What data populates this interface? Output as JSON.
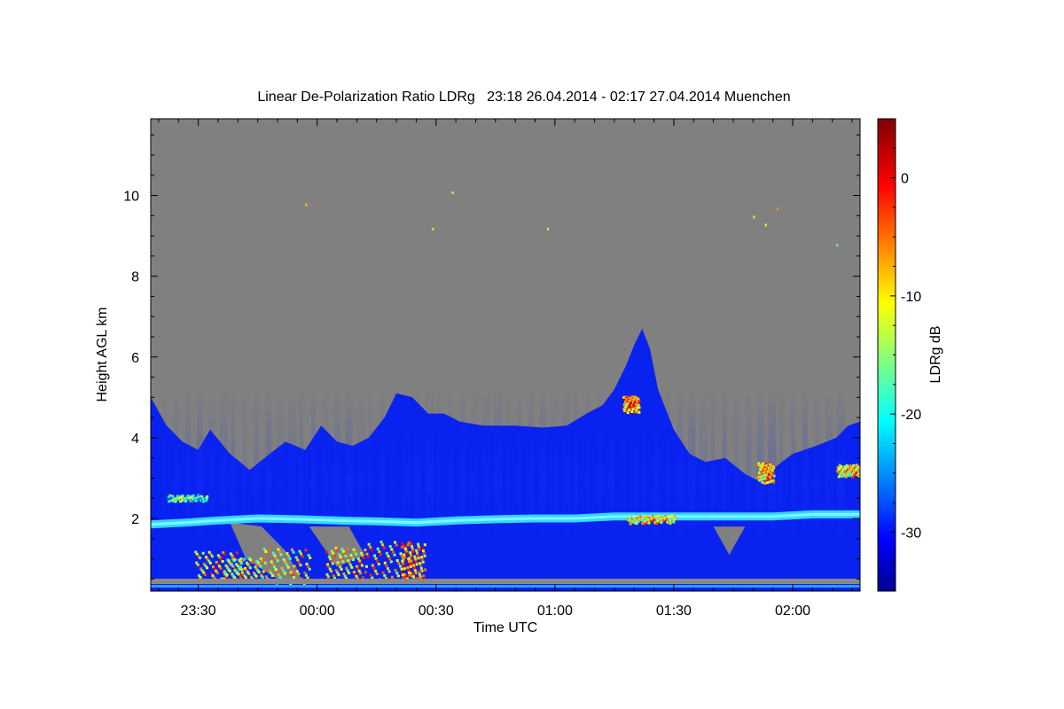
{
  "chart_data": {
    "type": "heatmap",
    "title": "Linear De-Polarization Ratio LDRg   23:18 26.04.2014 - 02:17 27.04.2014 Muenchen",
    "xlabel": "Time UTC",
    "ylabel": "Height AGL km",
    "xlim_minutes_after_midnight": [
      -42,
      137
    ],
    "ylim_km": [
      0.2,
      11.9
    ],
    "x_ticks": [
      {
        "label": "23:30",
        "minutes": -30
      },
      {
        "label": "00:00",
        "minutes": 0
      },
      {
        "label": "00:30",
        "minutes": 30
      },
      {
        "label": "01:00",
        "minutes": 60
      },
      {
        "label": "01:30",
        "minutes": 90
      },
      {
        "label": "02:00",
        "minutes": 120
      }
    ],
    "y_ticks": [
      {
        "label": "2",
        "km": 2
      },
      {
        "label": "4",
        "km": 4
      },
      {
        "label": "6",
        "km": 6
      },
      {
        "label": "8",
        "km": 8
      },
      {
        "label": "10",
        "km": 10
      }
    ],
    "colorbar": {
      "label": "LDRg dB",
      "range": [
        -35,
        5
      ],
      "ticks": [
        {
          "label": "0",
          "value": 0
        },
        {
          "label": "-10",
          "value": -10
        },
        {
          "label": "-20",
          "value": -20
        },
        {
          "label": "-30",
          "value": -30
        }
      ],
      "colormap": "jet"
    },
    "no_signal_color": "#808080",
    "cloud_top_km": [
      [
        -42,
        5.0
      ],
      [
        -38,
        4.3
      ],
      [
        -34,
        3.9
      ],
      [
        -30,
        3.7
      ],
      [
        -27,
        4.2
      ],
      [
        -22,
        3.6
      ],
      [
        -17,
        3.2
      ],
      [
        -12,
        3.6
      ],
      [
        -8,
        3.9
      ],
      [
        -3,
        3.7
      ],
      [
        1,
        4.3
      ],
      [
        5,
        3.9
      ],
      [
        9,
        3.8
      ],
      [
        13,
        4.0
      ],
      [
        17,
        4.5
      ],
      [
        20,
        5.1
      ],
      [
        24,
        5.0
      ],
      [
        28,
        4.6
      ],
      [
        32,
        4.6
      ],
      [
        36,
        4.4
      ],
      [
        42,
        4.3
      ],
      [
        50,
        4.3
      ],
      [
        57,
        4.25
      ],
      [
        63,
        4.3
      ],
      [
        68,
        4.6
      ],
      [
        72,
        4.8
      ],
      [
        75,
        5.2
      ],
      [
        78,
        5.8
      ],
      [
        80,
        6.3
      ],
      [
        82,
        6.7
      ],
      [
        84,
        6.2
      ],
      [
        86,
        5.2
      ],
      [
        88,
        4.7
      ],
      [
        90,
        4.2
      ],
      [
        94,
        3.6
      ],
      [
        98,
        3.4
      ],
      [
        103,
        3.5
      ],
      [
        108,
        3.1
      ],
      [
        112,
        2.9
      ],
      [
        116,
        3.3
      ],
      [
        120,
        3.6
      ],
      [
        126,
        3.8
      ],
      [
        131,
        4.0
      ],
      [
        134,
        4.3
      ],
      [
        137,
        4.4
      ]
    ],
    "bright_layer_km": [
      [
        -42,
        1.85
      ],
      [
        -33,
        1.9
      ],
      [
        -25,
        1.95
      ],
      [
        -15,
        2.0
      ],
      [
        -5,
        1.98
      ],
      [
        5,
        1.95
      ],
      [
        15,
        1.93
      ],
      [
        25,
        1.9
      ],
      [
        35,
        1.95
      ],
      [
        45,
        1.98
      ],
      [
        55,
        2.0
      ],
      [
        65,
        2.0
      ],
      [
        75,
        2.05
      ],
      [
        85,
        2.05
      ],
      [
        95,
        2.05
      ],
      [
        105,
        2.05
      ],
      [
        115,
        2.05
      ],
      [
        125,
        2.1
      ],
      [
        137,
        2.1
      ]
    ],
    "scattered_points": [
      [
        -3,
        9.8,
        -8
      ],
      [
        34,
        10.1,
        -12
      ],
      [
        29,
        9.2,
        -9
      ],
      [
        58,
        9.2,
        -12
      ],
      [
        110,
        9.5,
        -12
      ],
      [
        116,
        9.7,
        -6
      ],
      [
        113,
        9.3,
        -10
      ],
      [
        131,
        8.8,
        -16
      ]
    ]
  }
}
